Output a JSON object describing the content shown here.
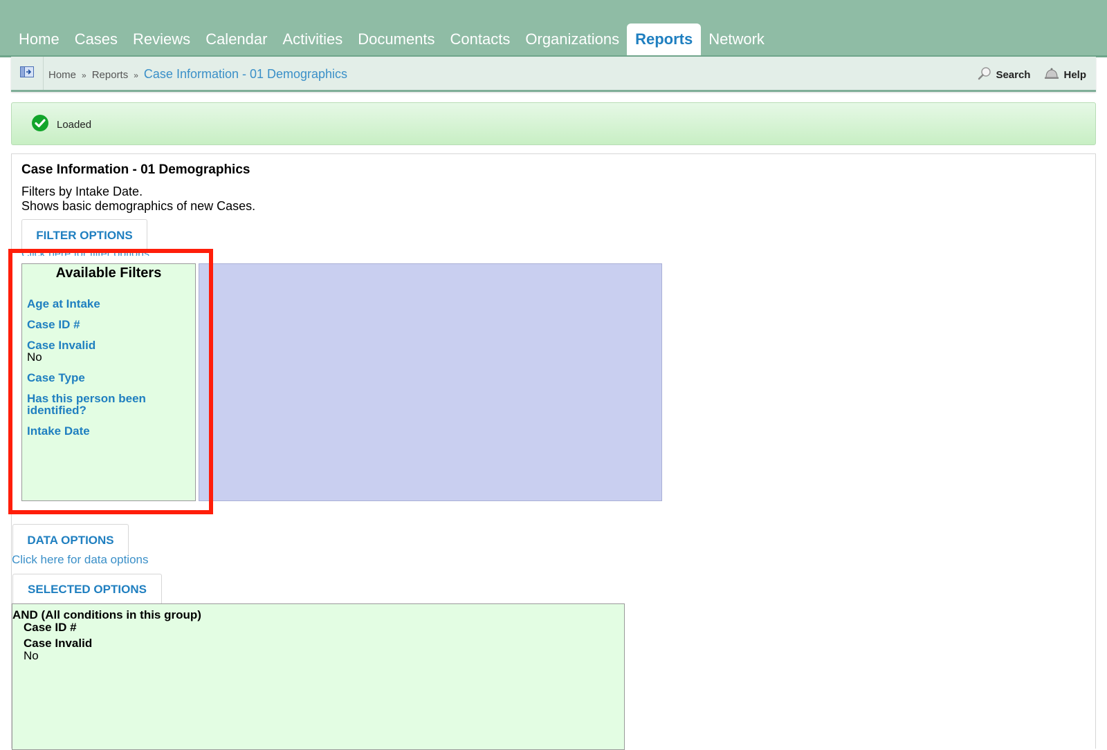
{
  "nav": {
    "tabs": [
      {
        "label": "Home"
      },
      {
        "label": "Cases"
      },
      {
        "label": "Reviews"
      },
      {
        "label": "Calendar"
      },
      {
        "label": "Activities"
      },
      {
        "label": "Documents"
      },
      {
        "label": "Contacts"
      },
      {
        "label": "Organizations"
      },
      {
        "label": "Reports",
        "active": true
      },
      {
        "label": "Network"
      }
    ]
  },
  "breadcrumb": {
    "home": "Home",
    "separator": "»",
    "reports": "Reports",
    "current": "Case Information - 01 Demographics"
  },
  "header_links": {
    "search": "Search",
    "help": "Help"
  },
  "status": {
    "message": "Loaded"
  },
  "report": {
    "title": "Case Information - 01 Demographics",
    "description_line1": "Filters by Intake Date.",
    "description_line2": "Shows basic demographics of new Cases."
  },
  "filter_options": {
    "tab_label": "FILTER OPTIONS",
    "hint": "Click here for filter options"
  },
  "available_filters": {
    "title": "Available Filters",
    "items": [
      {
        "label": "Age at Intake",
        "value": ""
      },
      {
        "label": "Case ID #",
        "value": ""
      },
      {
        "label": "Case Invalid",
        "value": "No"
      },
      {
        "label": "Case Type",
        "value": ""
      },
      {
        "label": "Has this person been identified?",
        "value": ""
      },
      {
        "label": "Intake Date",
        "value": ""
      }
    ]
  },
  "data_options": {
    "tab_label": "DATA OPTIONS",
    "hint": "Click here for data options"
  },
  "selected_options": {
    "tab_label": "SELECTED OPTIONS",
    "condition": "AND (All conditions in this group)",
    "items": [
      {
        "label": "Case ID #",
        "value": ""
      },
      {
        "label": "Case Invalid",
        "value": "No"
      }
    ]
  },
  "colors": {
    "topbar": "#8fbca5",
    "accent": "#1f7fc0",
    "filter_bg": "#e3fde3",
    "drop_bg": "#c9cff0",
    "highlight": "#ff1e0a"
  }
}
